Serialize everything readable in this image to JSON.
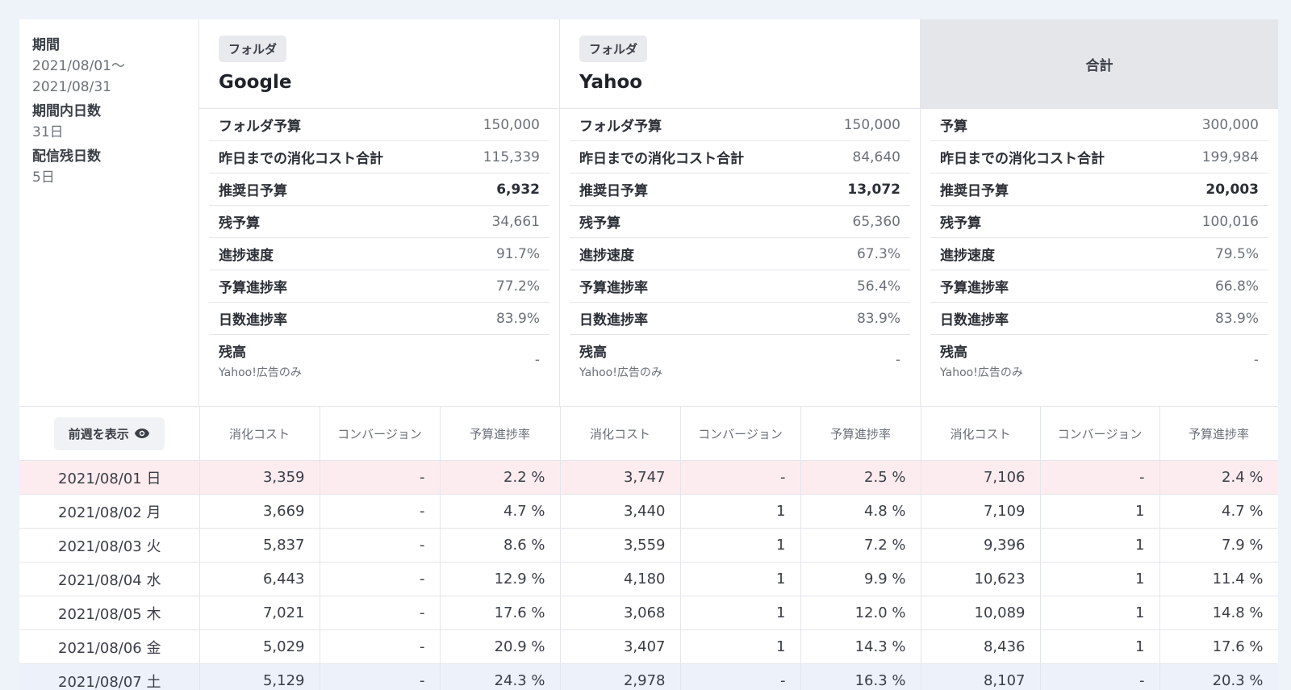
{
  "period": {
    "label": "期間",
    "value_line1": "2021/08/01〜",
    "value_line2": "2021/08/31",
    "days_label": "期間内日数",
    "days_value": "31日",
    "remaining_label": "配信残日数",
    "remaining_value": "5日"
  },
  "folders": [
    {
      "tag": "フォルダ",
      "name": "Google",
      "metrics": [
        {
          "label": "フォルダ予算",
          "value": "150,000"
        },
        {
          "label": "昨日までの消化コスト合計",
          "value": "115,339"
        },
        {
          "label": "推奨日予算",
          "value": "6,932"
        },
        {
          "label": "残予算",
          "value": "34,661"
        },
        {
          "label": "進捗速度",
          "value": "91.7%"
        },
        {
          "label": "予算進捗率",
          "value": "77.2%"
        },
        {
          "label": "日数進捗率",
          "value": "83.9%"
        }
      ],
      "balance": {
        "label": "残高",
        "sub": "Yahoo!広告のみ",
        "value": "-"
      }
    },
    {
      "tag": "フォルダ",
      "name": "Yahoo",
      "metrics": [
        {
          "label": "フォルダ予算",
          "value": "150,000"
        },
        {
          "label": "昨日までの消化コスト合計",
          "value": "84,640"
        },
        {
          "label": "推奨日予算",
          "value": "13,072"
        },
        {
          "label": "残予算",
          "value": "65,360"
        },
        {
          "label": "進捗速度",
          "value": "67.3%"
        },
        {
          "label": "予算進捗率",
          "value": "56.4%"
        },
        {
          "label": "日数進捗率",
          "value": "83.9%"
        }
      ],
      "balance": {
        "label": "残高",
        "sub": "Yahoo!広告のみ",
        "value": "-"
      }
    }
  ],
  "total": {
    "title": "合計",
    "metrics": [
      {
        "label": "予算",
        "value": "300,000"
      },
      {
        "label": "昨日までの消化コスト合計",
        "value": "199,984"
      },
      {
        "label": "推奨日予算",
        "value": "20,003"
      },
      {
        "label": "残予算",
        "value": "100,016"
      },
      {
        "label": "進捗速度",
        "value": "79.5%"
      },
      {
        "label": "予算進捗率",
        "value": "66.8%"
      },
      {
        "label": "日数進捗率",
        "value": "83.9%"
      }
    ],
    "balance": {
      "label": "残高",
      "sub": "Yahoo!広告のみ",
      "value": "-"
    }
  },
  "table": {
    "prev_week_button": "前週を表示",
    "column_headers": [
      "消化コスト",
      "コンバージョン",
      "予算進捗率",
      "消化コスト",
      "コンバージョン",
      "予算進捗率",
      "消化コスト",
      "コンバージョン",
      "予算進捗率"
    ],
    "rows": [
      {
        "date": "2021/08/01 日",
        "cells": [
          "3,359",
          "-",
          "2.2 %",
          "3,747",
          "-",
          "2.5 %",
          "7,106",
          "-",
          "2.4 %"
        ]
      },
      {
        "date": "2021/08/02 月",
        "cells": [
          "3,669",
          "-",
          "4.7 %",
          "3,440",
          "1",
          "4.8 %",
          "7,109",
          "1",
          "4.7 %"
        ]
      },
      {
        "date": "2021/08/03 火",
        "cells": [
          "5,837",
          "-",
          "8.6 %",
          "3,559",
          "1",
          "7.2 %",
          "9,396",
          "1",
          "7.9 %"
        ]
      },
      {
        "date": "2021/08/04 水",
        "cells": [
          "6,443",
          "-",
          "12.9 %",
          "4,180",
          "1",
          "9.9 %",
          "10,623",
          "1",
          "11.4 %"
        ]
      },
      {
        "date": "2021/08/05 木",
        "cells": [
          "7,021",
          "-",
          "17.6 %",
          "3,068",
          "1",
          "12.0 %",
          "10,089",
          "1",
          "14.8 %"
        ]
      },
      {
        "date": "2021/08/06 金",
        "cells": [
          "5,029",
          "-",
          "20.9 %",
          "3,407",
          "1",
          "14.3 %",
          "8,436",
          "1",
          "17.6 %"
        ]
      },
      {
        "date": "2021/08/07 土",
        "cells": [
          "5,129",
          "-",
          "24.3 %",
          "2,978",
          "-",
          "16.3 %",
          "8,107",
          "-",
          "20.3 %"
        ]
      }
    ]
  }
}
